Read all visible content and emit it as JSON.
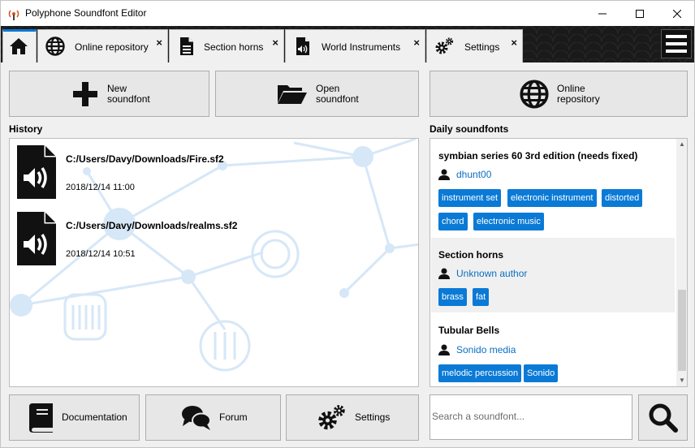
{
  "window": {
    "title": "Polyphone Soundfont Editor"
  },
  "tabs": [
    {
      "label": "Online repository",
      "icon": "globe-icon"
    },
    {
      "label": "Section horns",
      "icon": "document-icon"
    },
    {
      "label": "World Instruments",
      "icon": "soundfont-file-icon"
    },
    {
      "label": "Settings",
      "icon": "gears-icon"
    }
  ],
  "tab_close_glyph": "×",
  "top_buttons": {
    "new_soundfont": "New\nsoundfont",
    "open_soundfont": "Open\nsoundfont",
    "online_repository": "Online\nrepository"
  },
  "history": {
    "title": "History",
    "items": [
      {
        "path": "C:/Users/Davy/Downloads/Fire.sf2",
        "date": "2018/12/14 11:00"
      },
      {
        "path": "C:/Users/Davy/Downloads/realms.sf2",
        "date": "2018/12/14 10:51"
      }
    ]
  },
  "daily": {
    "title": "Daily soundfonts",
    "items": [
      {
        "title": "symbian series 60 3rd edition (needs fixed)",
        "author": "dhunt00",
        "tags": [
          "instrument set",
          "electronic instrument",
          "distorted",
          "chord",
          "electronic music"
        ]
      },
      {
        "title": "Section horns",
        "author": "Unknown author",
        "tags": [
          "brass",
          "fat"
        ]
      },
      {
        "title": "Tubular Bells",
        "author": "Sonido media",
        "tags": [
          "melodic percussion",
          "Sonido"
        ]
      }
    ]
  },
  "bottom_buttons": {
    "documentation": "Documentation",
    "forum": "Forum",
    "settings": "Settings"
  },
  "search": {
    "placeholder": "Search a soundfont..."
  },
  "colors": {
    "accent": "#0a7ad6",
    "link": "#0a6fc2",
    "background_art": "#cfe3f6"
  }
}
